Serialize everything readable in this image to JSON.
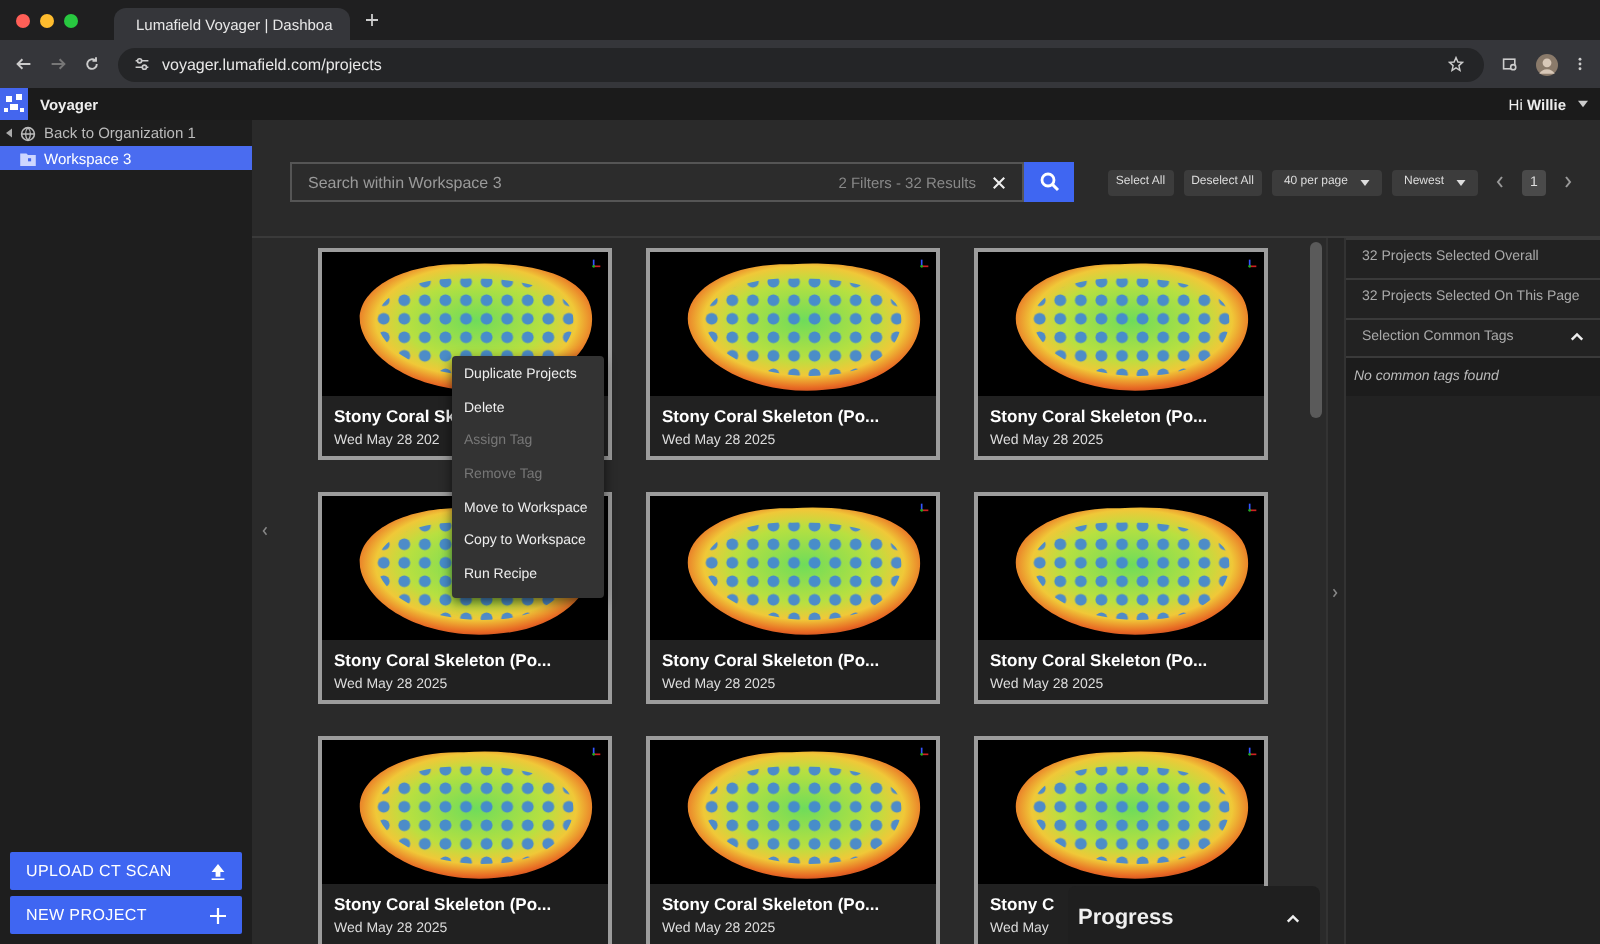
{
  "browser": {
    "tab_title": "Lumafield Voyager | Dashboa",
    "url": "voyager.lumafield.com/projects"
  },
  "app": {
    "name": "Voyager",
    "greeting": "Hi **Willie**"
  },
  "sidebar": {
    "back_link": "Back to Organization 1",
    "items": [
      {
        "label": "Workspace 3",
        "selected": true
      }
    ],
    "buttons": [
      {
        "label": "UPLOAD CT SCAN",
        "kind": "upload"
      },
      {
        "label": "NEW PROJECT",
        "kind": "add"
      }
    ]
  },
  "search": {
    "placeholder": "Search within Workspace 3",
    "summary": "2 Filters - 32 Results"
  },
  "toolbar": {
    "buttons": [
      "Select All",
      "Deselect All"
    ],
    "dropdowns": [
      "40 per page",
      "Newest"
    ],
    "pages": [
      {
        "label": "1",
        "selected": true
      }
    ]
  },
  "projects": [
    {
      "title": "Stony Coral Sk",
      "date": "Wed May 28 202"
    },
    {
      "title": "Stony Coral Skeleton (Po...",
      "date": "Wed May 28 2025"
    },
    {
      "title": "Stony Coral Skeleton (Po...",
      "date": "Wed May 28 2025"
    },
    {
      "title": "Stony Coral Skeleton (Po...",
      "date": "Wed May 28 2025"
    },
    {
      "title": "Stony Coral Skeleton (Po...",
      "date": "Wed May 28 2025"
    },
    {
      "title": "Stony Coral Skeleton (Po...",
      "date": "Wed May 28 2025"
    },
    {
      "title": "Stony Coral Skeleton (Po...",
      "date": "Wed May 28 2025"
    },
    {
      "title": "Stony Coral Skeleton (Po...",
      "date": "Wed May 28 2025"
    },
    {
      "title": "Stony C",
      "date": "Wed May"
    }
  ],
  "context_menu": {
    "items": [
      {
        "label": "Duplicate Projects",
        "disabled": false
      },
      {
        "label": "Delete",
        "disabled": false
      },
      {
        "label": "Assign Tag",
        "disabled": true
      },
      {
        "label": "Remove Tag",
        "disabled": true
      },
      {
        "label": "Move to Workspace",
        "disabled": false
      },
      {
        "label": "Copy to Workspace",
        "disabled": false
      },
      {
        "label": "Run Recipe",
        "disabled": false
      }
    ]
  },
  "selection_panel": {
    "rows": [
      "32 Projects Selected Overall",
      "32 Projects Selected On This Page"
    ],
    "tags_header": "Selection Common Tags",
    "expanded": true,
    "empty_text": "No common tags found"
  },
  "progress": {
    "title": "Progress",
    "expanded": false
  }
}
